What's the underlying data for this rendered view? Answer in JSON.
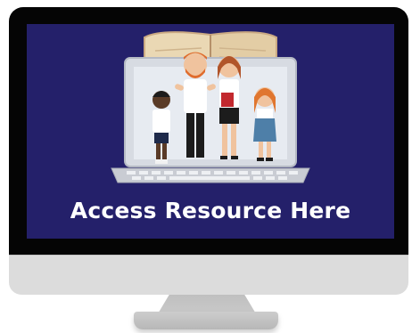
{
  "screen": {
    "headline": "Access Resource Here",
    "background_color": "#24206a",
    "text_color": "#ffffff"
  },
  "illustration": {
    "icons": [
      "open-book-icon",
      "laptop-icon",
      "keyboard-icon",
      "teacher-icon",
      "student-icon"
    ]
  }
}
